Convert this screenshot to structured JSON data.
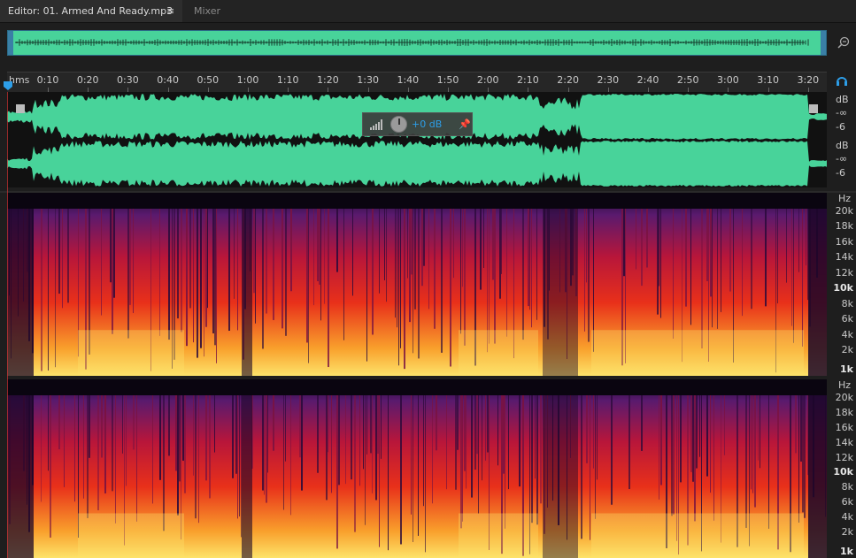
{
  "tabs": {
    "editor_label": "Editor: 01. Armed And Ready.mp3",
    "menu_glyph": "≡",
    "mixer_label": "Mixer"
  },
  "ruler": {
    "unit": "hms",
    "ticks": [
      "0:10",
      "0:20",
      "0:30",
      "0:40",
      "0:50",
      "1:00",
      "1:10",
      "1:20",
      "1:30",
      "1:40",
      "1:50",
      "2:00",
      "2:10",
      "2:20",
      "2:30",
      "2:40",
      "2:50",
      "3:00",
      "3:10",
      "3:20"
    ]
  },
  "db_scale": {
    "ch1": [
      "dB",
      "-∞",
      "-6"
    ],
    "ch2": [
      "dB",
      "-∞",
      "-6"
    ]
  },
  "hud": {
    "gain": "+0 dB",
    "pin_icon": "pin-icon"
  },
  "hz_scale": {
    "ch1": [
      {
        "label": "Hz",
        "bold": false
      },
      {
        "label": "20k",
        "bold": false
      },
      {
        "label": "18k",
        "bold": false
      },
      {
        "label": "16k",
        "bold": false
      },
      {
        "label": "14k",
        "bold": false
      },
      {
        "label": "12k",
        "bold": false
      },
      {
        "label": "10k",
        "bold": true
      },
      {
        "label": "8k",
        "bold": false
      },
      {
        "label": "6k",
        "bold": false
      },
      {
        "label": "4k",
        "bold": false
      },
      {
        "label": "2k",
        "bold": false
      },
      {
        "label": "1k",
        "bold": true
      }
    ],
    "ch2": [
      {
        "label": "Hz",
        "bold": false
      },
      {
        "label": "20k",
        "bold": false
      },
      {
        "label": "18k",
        "bold": false
      },
      {
        "label": "16k",
        "bold": false
      },
      {
        "label": "14k",
        "bold": false
      },
      {
        "label": "12k",
        "bold": false
      },
      {
        "label": "10k",
        "bold": true
      },
      {
        "label": "8k",
        "bold": false
      },
      {
        "label": "6k",
        "bold": false
      },
      {
        "label": "4k",
        "bold": false
      },
      {
        "label": "2k",
        "bold": false
      },
      {
        "label": "1k",
        "bold": true
      }
    ]
  },
  "colors": {
    "waveform": "#48d39a",
    "accent_blue": "#2d9ee8",
    "background": "#1e1e1e"
  }
}
